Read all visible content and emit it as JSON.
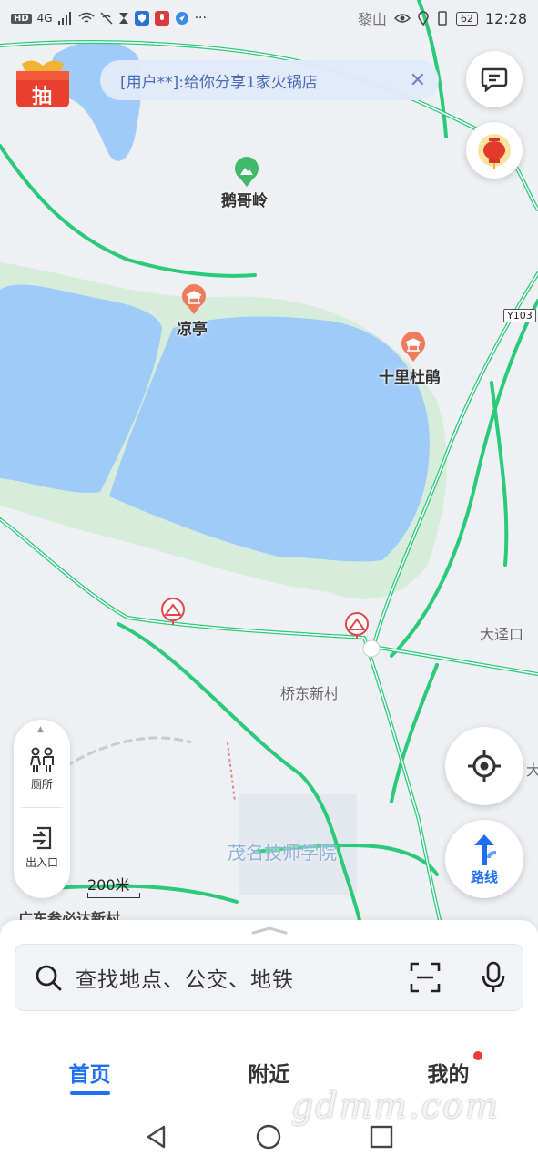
{
  "status_bar": {
    "left_badges": [
      "HD",
      "4G"
    ],
    "carrier_text": "黎山",
    "battery": "62",
    "time": "12:28"
  },
  "banner": {
    "text": "[用户**]:给你分享1家火锅店",
    "close_icon": "close-icon"
  },
  "lottery": {
    "label": "抽"
  },
  "map": {
    "pois": [
      {
        "name": "鹅哥岭",
        "icon": "mountain-icon"
      },
      {
        "name": "凉亭",
        "icon": "pavilion-icon"
      },
      {
        "name": "十里杜鹃",
        "icon": "pavilion-icon"
      }
    ],
    "areas": [
      "桥东新村",
      "茂名技师学院",
      "大迳口",
      "广东参必达新村",
      "大"
    ],
    "road_shield": "Y103",
    "colors": {
      "water": "#9ecbf7",
      "park": "#d6eddc",
      "road": "#2bc97a",
      "land": "#eef0f3"
    }
  },
  "tool_panel": {
    "items": [
      {
        "label": "厕所",
        "icon": "toilet-icon"
      },
      {
        "label": "出入口",
        "icon": "entrance-icon"
      }
    ]
  },
  "scale": {
    "label": "200米"
  },
  "route_button": {
    "label": "路线"
  },
  "search": {
    "placeholder": "查找地点、公交、地铁"
  },
  "tabs": [
    {
      "label": "首页",
      "active": true
    },
    {
      "label": "附近",
      "active": false
    },
    {
      "label": "我的",
      "active": false,
      "badge": true
    }
  ],
  "watermark": "gdmm.com",
  "accent": "#1f6ff2"
}
